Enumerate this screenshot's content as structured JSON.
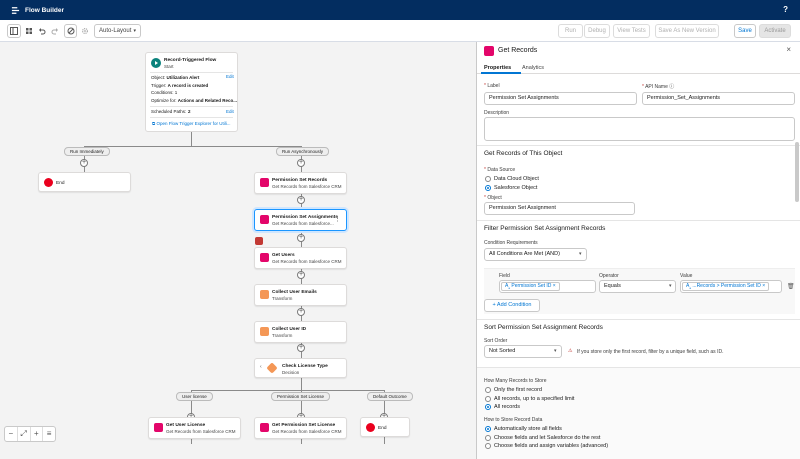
{
  "app": {
    "title": "Flow Builder",
    "help": "?"
  },
  "toolbar": {
    "layout_select": "Auto-Layout",
    "run": "Run",
    "debug": "Debug",
    "view_tests": "View Tests",
    "save_as": "Save As New Version",
    "save": "Save",
    "activate": "Activate"
  },
  "start": {
    "title": "Record-Triggered Flow",
    "subtitle": "Start",
    "object_label": "Object:",
    "object_value": "Utilization Alert",
    "trigger_label": "Trigger:",
    "trigger_value": "A record is created",
    "conditions": "Conditions: 1",
    "optimize_label": "Optimize for:",
    "optimize_value": "Actions and Related Reco...",
    "scheduled": "Scheduled Paths:",
    "scheduled_value": "2",
    "edit": "Edit",
    "explorer": "Open Flow Trigger Explorer for Utili..."
  },
  "paths": {
    "left": "Run Immediately",
    "right": "Run Asynchronously"
  },
  "nodes": {
    "end1": "End",
    "psr_title": "Permission Set Records",
    "psr_sub": "Get Records from Salesforce CRM",
    "psa_title": "Permission Set Assignments",
    "psa_sub": "Get Records from Salesforce...",
    "users_title": "Get Users",
    "users_sub": "Get Records from Salesforce CRM",
    "emails_title": "Collect User Emails",
    "emails_sub": "Transform",
    "uid_title": "Collect User ID",
    "uid_sub": "Transform",
    "lic_title": "Check License Type",
    "lic_sub": "Decision",
    "out1": "User license",
    "out2": "Permission Set License",
    "out3": "Default Outcome",
    "gul_title": "Get User License",
    "gul_sub": "Get Records from Salesforce CRM",
    "gpsl_title": "Get Permission Set License",
    "gpsl_sub": "Get Records from Salesforce CRM",
    "end2": "End"
  },
  "panel": {
    "header": "Get Records",
    "tab_properties": "Properties",
    "tab_analytics": "Analytics",
    "label_lbl": "Label",
    "label_val": "Permission Set Assignments",
    "api_lbl": "API Name",
    "api_val": "Permission_Set_Assignments",
    "desc_lbl": "Description",
    "get_records_of": "Get Records of This Object",
    "data_source": "Data Source",
    "ds_opt1": "Data Cloud Object",
    "ds_opt2": "Salesforce Object",
    "object_lbl": "Object",
    "object_val": "Permission Set Assignment",
    "filter_title": "Filter Permission Set Assignment Records",
    "cond_req": "Condition Requirements",
    "cond_val": "All Conditions Are Met (AND)",
    "col_field": "Field",
    "col_op": "Operator",
    "col_value": "Value",
    "field_val": "Permission Set ID",
    "op_val": "Equals",
    "value_val": "...Records > Permission Set ID",
    "add_cond": "+ Add Condition",
    "sort_title": "Sort Permission Set Assignment Records",
    "sort_order": "Sort Order",
    "sort_val": "Not Sorted",
    "sort_hint": "If you store only the first record, filter by a unique field, such as ID.",
    "how_many": "How Many Records to Store",
    "hm1": "Only the first record",
    "hm2": "All records, up to a specified limit",
    "hm3": "All records",
    "how_store": "How to Store Record Data",
    "hs1": "Automatically store all fields",
    "hs2": "Choose fields and let Salesforce do the rest",
    "hs3": "Choose fields and assign variables (advanced)"
  },
  "colors": {
    "nav": "#032d60",
    "accent": "#0176d3",
    "pink": "#e3066a",
    "orange": "#f49756",
    "red": "#ea001e"
  }
}
